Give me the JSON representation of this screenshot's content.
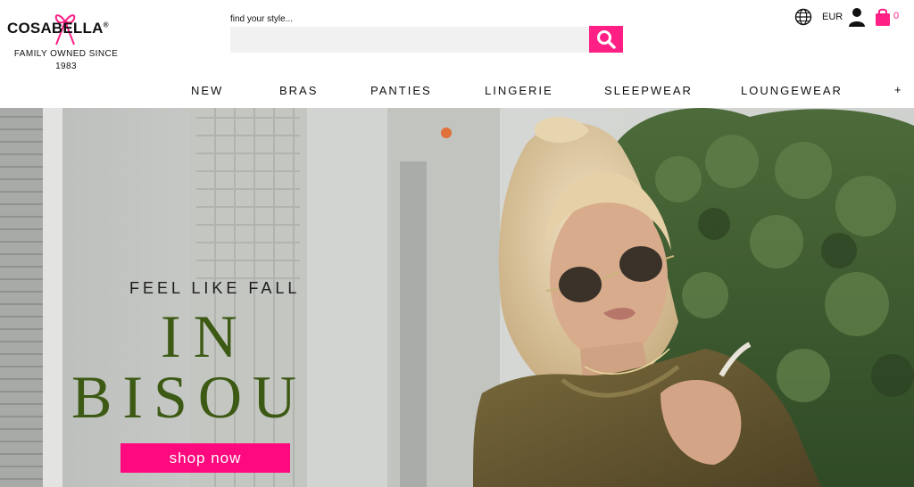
{
  "brand": {
    "name": "COSABELLA",
    "registered": "®",
    "tagline": "FAMILY OWNED SINCE",
    "year": "1983"
  },
  "search": {
    "label": "find your style...",
    "value": "",
    "icon": "search-icon"
  },
  "utility": {
    "region_icon": "globe-icon",
    "currency": "EUR",
    "account_icon": "user-icon",
    "cart_icon": "shopping-bag-icon",
    "cart_count": "0"
  },
  "nav": {
    "items": [
      "NEW",
      "BRAS",
      "PANTIES",
      "LINGERIE",
      "SLEEPWEAR",
      "LOUNGEWEAR"
    ],
    "more": "+"
  },
  "hero": {
    "subtitle": "FEEL LIKE FALL",
    "title_line1": "IN",
    "title_line2": "BISOU",
    "cta": "shop now"
  },
  "colors": {
    "accent": "#ff1f85",
    "hero_title": "#3d5a14"
  }
}
